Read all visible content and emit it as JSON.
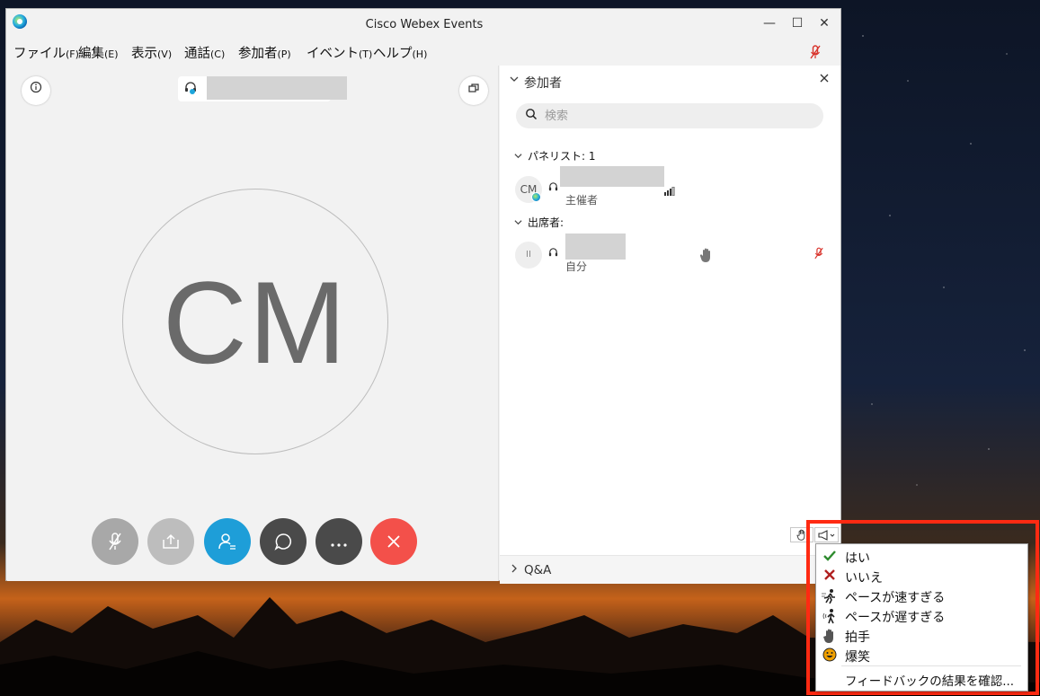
{
  "window": {
    "title": "Cisco Webex Events",
    "controls": {
      "minimize": "—",
      "maximize": "☐",
      "close": "✕"
    }
  },
  "menubar": {
    "items": [
      {
        "label": "ファイル",
        "key": "(F)"
      },
      {
        "label": "編集",
        "key": "(E)"
      },
      {
        "label": "表示",
        "key": "(V)"
      },
      {
        "label": "通話",
        "key": "(C)"
      },
      {
        "label": "参加者",
        "key": "(P)"
      },
      {
        "label": "イベント",
        "key": "(T)"
      },
      {
        "label": "ヘルプ",
        "key": "(H)"
      }
    ]
  },
  "stage": {
    "active_speaker_initials": "CM",
    "controls": [
      "mute",
      "share",
      "participants",
      "chat",
      "more",
      "leave"
    ]
  },
  "participants_panel": {
    "title": "参加者",
    "search_placeholder": "検索",
    "panelists_header": "パネリスト: 1",
    "attendees_header": "出席者:",
    "panelists": [
      {
        "initials": "CM",
        "role": "主催者"
      }
    ],
    "attendees": [
      {
        "initials": "II",
        "role": "自分"
      }
    ],
    "qa_label": "Q&A"
  },
  "feedback_menu": {
    "items": [
      {
        "icon": "check-icon",
        "label": "はい",
        "color": "#2e8b2e"
      },
      {
        "icon": "cross-icon",
        "label": "いいえ",
        "color": "#b02020"
      },
      {
        "icon": "running-man-icon",
        "label": "ペースが速すぎる",
        "color": "#222222"
      },
      {
        "icon": "walking-man-icon",
        "label": "ペースが遅すぎる",
        "color": "#222222"
      },
      {
        "icon": "clap-hands-icon",
        "label": "拍手",
        "color": "#555555"
      },
      {
        "icon": "laugh-face-icon",
        "label": "爆笑",
        "color": "#f0a000"
      }
    ],
    "results_label": "フィードバックの結果を確認..."
  },
  "colors": {
    "accent_blue": "#1e9ed8",
    "leave_red": "#f3504a",
    "mute_red": "#d8322a",
    "highlight_red": "#ff2a12"
  }
}
